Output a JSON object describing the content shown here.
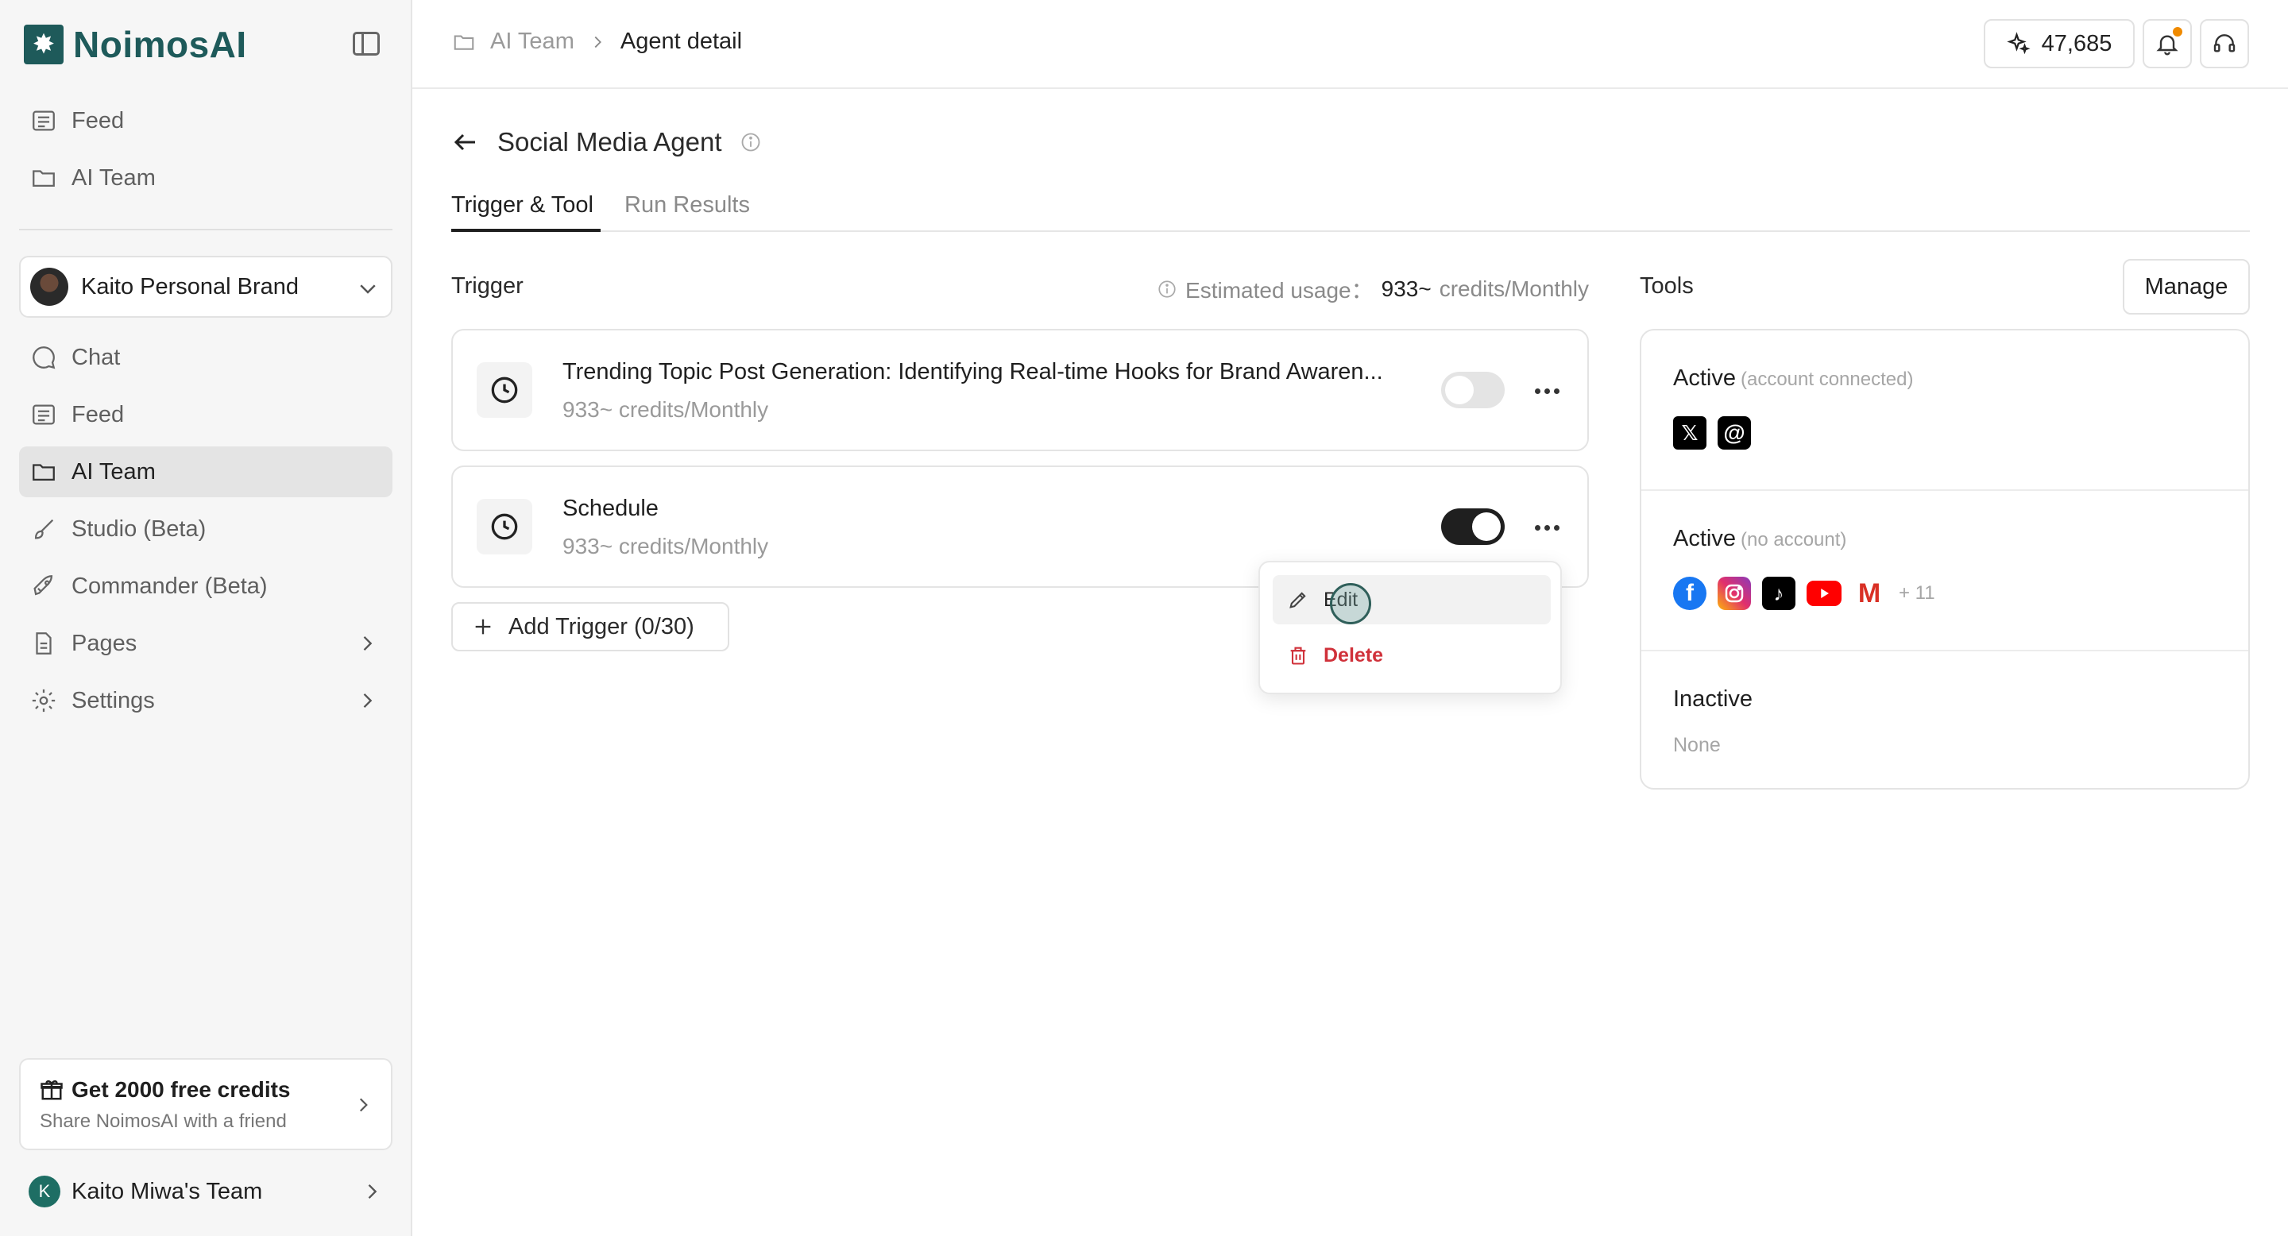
{
  "app": {
    "name": "NoimosAI"
  },
  "sidebar": {
    "top_items": [
      {
        "label": "Feed",
        "icon": "feed-icon"
      },
      {
        "label": "AI Team",
        "icon": "folder-icon"
      }
    ],
    "brand": {
      "name": "Kaito Personal Brand"
    },
    "items": [
      {
        "label": "Chat",
        "icon": "chat-icon"
      },
      {
        "label": "Feed",
        "icon": "feed-icon"
      },
      {
        "label": "AI Team",
        "icon": "folder-icon",
        "active": true
      },
      {
        "label": "Studio (Beta)",
        "icon": "brush-icon"
      },
      {
        "label": "Commander (Beta)",
        "icon": "rocket-icon"
      },
      {
        "label": "Pages",
        "icon": "page-icon",
        "expandable": true
      },
      {
        "label": "Settings",
        "icon": "gear-icon",
        "expandable": true
      }
    ],
    "referral": {
      "title": "Get 2000 free credits",
      "subtitle": "Share NoimosAI with a friend"
    },
    "team": {
      "initial": "K",
      "name": "Kaito Miwa's Team"
    }
  },
  "topbar": {
    "breadcrumb": [
      "AI Team",
      "Agent detail"
    ],
    "credits": "47,685"
  },
  "page": {
    "title": "Social Media Agent",
    "tabs": [
      "Trigger & Tool",
      "Run Results"
    ]
  },
  "trigger": {
    "heading": "Trigger",
    "usage_label": "Estimated usage：",
    "usage_value": "933~",
    "usage_unit": "credits/Monthly",
    "cards": [
      {
        "title": "Trending Topic Post Generation: Identifying Real-time Hooks for Brand Awaren...",
        "subtitle": "933~ credits/Monthly",
        "enabled": false
      },
      {
        "title": "Schedule",
        "subtitle": "933~ credits/Monthly",
        "enabled": true
      }
    ],
    "add_label": "Add Trigger (0/30)"
  },
  "menu": {
    "edit": "Edit",
    "delete": "Delete"
  },
  "tools": {
    "heading": "Tools",
    "manage_label": "Manage",
    "sections": [
      {
        "title": "Active",
        "note": "(account connected)",
        "icons": [
          "x-icon",
          "threads-icon"
        ]
      },
      {
        "title": "Active",
        "note": "(no account)",
        "icons": [
          "facebook-icon",
          "instagram-icon",
          "tiktok-icon",
          "youtube-icon",
          "gmail-icon"
        ],
        "more": "+ 11"
      },
      {
        "title": "Inactive",
        "none_label": "None"
      }
    ]
  },
  "colors": {
    "brand": "#1e5a5a",
    "danger": "#d0313a",
    "notification": "#f08a00"
  }
}
